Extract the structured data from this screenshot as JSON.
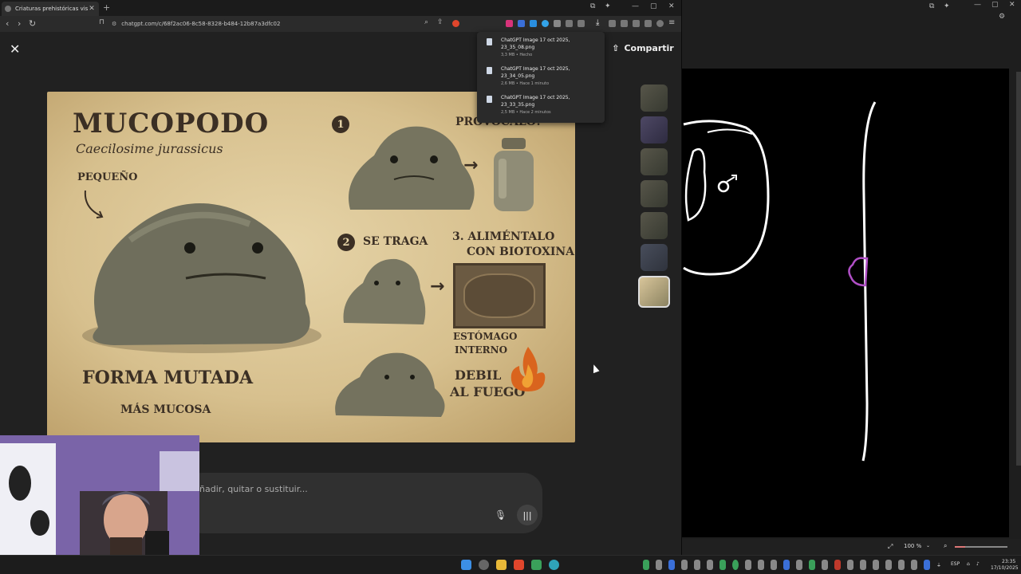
{
  "browser": {
    "tab_title": "Criaturas prehistóricas viscosas",
    "url": "chatgpt.com/c/68f2ac06-8c58-8328-b484-12b87a3dfc02"
  },
  "viewer": {
    "share_label": "Compartir",
    "prompt_placeholder": "ñadir, quitar o sustituir..."
  },
  "poster": {
    "title": "MUCOPODO",
    "subtitle": "Caecilosime jurassicus",
    "small_label": "PEQUEÑO",
    "step1_number": "1",
    "step1_label": "PROVOCALO!",
    "step2_number": "2",
    "step2_label": "SE TRAGA",
    "step3_label_line1": "3. ALIMÉNTALO",
    "step3_label_line2": "CON BIOTOXINA",
    "stomach_line1": "ESTÓMAGO",
    "stomach_line2": "INTERNO",
    "weak_line1": "DEBIL",
    "weak_line2": "AL FUEGO",
    "form_label": "FORMA MUTADA",
    "more_label": "MÁS MUCOSA"
  },
  "downloads": [
    {
      "name": "ChatGPT Image 17 oct 2025, 23_35_08.png",
      "meta": "3,3 MB • Hecho"
    },
    {
      "name": "ChatGPT Image 17 oct 2025, 23_34_05.png",
      "meta": "2,6 MB • Hace 1 minuto"
    },
    {
      "name": "ChatGPT Image 17 oct 2025, 23_33_35.png",
      "meta": "2,5 MB • Hace 2 minutos"
    }
  ],
  "drawing_app": {
    "zoom": "100 %",
    "zoom_fraction": 0.2
  },
  "taskbar": {
    "language": "ESP",
    "time": "23:35",
    "date": "17/10/2025"
  }
}
